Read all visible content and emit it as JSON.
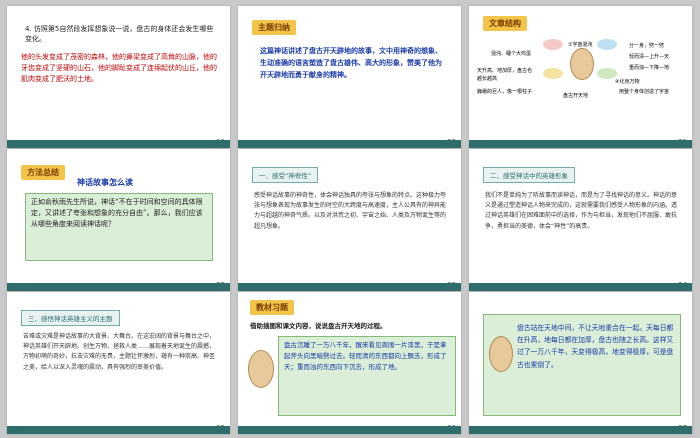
{
  "slides": [
    {
      "number": "19",
      "title": "4. 仿照第5自然段发挥想象说一说，盘古的身体还会发生哪些变化。",
      "answer": "他的头发变成了茂密的森林，他的鼻梁变成了高耸的山脉，他的牙齿变成了坚硬的山石，他的脚趾变成了连绵起伏的山丘，他的肌肉变成了肥沃的土地。"
    },
    {
      "number": "20",
      "heading": "主题归纳",
      "body": "这篇神话讲述了盘古开天辟地的故事，文中用神奇的想象、生动准确的语言塑造了盘古雄伟、高大的形象，赞美了他为开天辟地而勇于献身的精神。"
    },
    {
      "number": "21",
      "heading": "文章结构",
      "left_nodes": [
        "混沌、睡个大鸡蛋",
        "天升高、地加厚，盘古也越长越高",
        "盘古倒下，身体化为万物",
        "巍峨的巨人，像一根柱子"
      ],
      "center": "盘古开天地",
      "right_nodes": [
        "①宇宙混沌",
        "②开辟天地",
        "③顶天立地",
        "④化身万物"
      ],
      "far_right": [
        "分一身，劈一劈",
        "轻而清—上升—天",
        "重而浊—下降—地",
        "用整个身体创造了宇宙"
      ]
    },
    {
      "number": "22",
      "heading": "方法总结",
      "subheading": "神话故事怎么读",
      "body": "正如俞秋雨先生所说，神话“不在于时间和空间的具体限定，又讲述了夸张和想象的充分自由”。那么，我们应该从哪些角度来阅读神话呢？"
    },
    {
      "number": "23",
      "section": "一、感受“神奇性”",
      "body": "感受神话故事的神奇性，体会神话独具的夸张与想象的特点。这种极力夸张与想象表现为故事发生的时空的大跨度与高速度，主人公具有的神异能力与超越的神奇气质。以及对洪荒之初、宇宙之始、人类及万物诞生等的超凡想象。"
    },
    {
      "number": "24",
      "section": "二、感受神话中的英雄形象",
      "body": "我们不是单纯为了听故事而读神话，而是为了寻找神话的意义。神话的意义是通过塑造神话人物来完成的，这就需要我们感受人物形象的内涵。透过神话英雄们在困难面前中的选择，作为与担当，发现他们不屈服、敢抗争，勇担当的美德，体会“神性”的高贵。"
    },
    {
      "number": "25",
      "section": "三、感悟神话英雄主义的主题",
      "body": "苦难或灾难是神话故事的大背景、大舞台。在这宏阔的背景与舞台之中，神话英雄们开天辟地、创生万物、拯救人类……展现着天地诞生的震撼，万物初萌的奇妙，抗击灾难的无畏，主题壮怀激烈，蕴有一种崇高、神圣之美，给人以深入灵魂的震动，具有强烈的审美价值。"
    },
    {
      "number": "26",
      "heading": "教材习题",
      "question": "借助插图和课文内容，说说盘古开天地的过程。",
      "answer": "盘古沉睡了一万八千年，醒来看见周围一片漆黑，于是拿起斧头向黑暗劈过去。轻而清的东西都向上飘去，形成了天；重而浊的东西向下沉去，形成了地。"
    },
    {
      "number": "27",
      "answer": "盘古站在天地中间，不让天地重合在一起。天每日都在升高，地每日都在加厚，盘古也随之长高。这样又过了一万八千年，天变得极高，地变得极厚，可是盘古也累倒了。"
    }
  ],
  "colors": {
    "teal": "#2e6d6b",
    "red": "#c00000",
    "green_bg": "#dbeed7",
    "label": "#f2c44a"
  }
}
